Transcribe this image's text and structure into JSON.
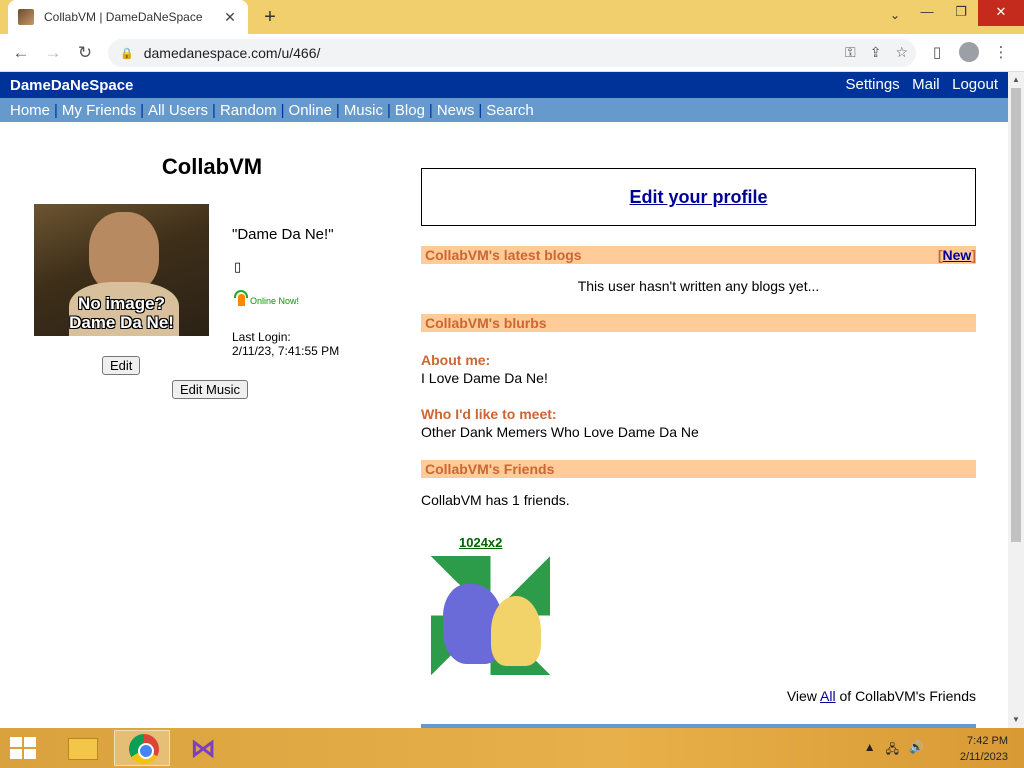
{
  "browser": {
    "tab_title": "CollabVM | DameDaNeSpace",
    "url": "damedanespace.com/u/466/"
  },
  "site": {
    "name": "DameDaNeSpace",
    "top_links": [
      "Settings",
      "Mail",
      "Logout"
    ],
    "nav": [
      "Home",
      "My Friends",
      "All Users",
      "Random",
      "Online",
      "Music",
      "Blog",
      "News",
      "Search"
    ]
  },
  "profile": {
    "name": "CollabVM",
    "image_caption_line1": "No image?",
    "image_caption_line2": "Dame Da Ne!",
    "quote": "\"Dame Da Ne!\"",
    "placeholder_glyph": "▯",
    "online_status": "Online Now!",
    "last_login_label": "Last Login:",
    "last_login_value": "2/11/23, 7:41:55 PM",
    "edit_button": "Edit",
    "edit_music_button": "Edit Music"
  },
  "right": {
    "edit_profile": "Edit your profile",
    "blogs_header": "CollabVM's latest blogs",
    "new_bracket_open": "[",
    "new_link": "New",
    "new_bracket_close": "]",
    "blogs_empty": "This user hasn't written any blogs yet...",
    "blurbs_header": "CollabVM's blurbs",
    "about_label": "About me:",
    "about_value": "I Love Dame Da Ne!",
    "meet_label": "Who I'd like to meet:",
    "meet_value": "Other Dank Memers Who Love Dame Da Ne",
    "friends_header": "CollabVM's Friends",
    "friends_count_text": "CollabVM has 1 friends.",
    "friend_name": "1024x2",
    "view_all_prefix": "View ",
    "view_all_link": "All",
    "view_all_suffix": " of CollabVM's Friends"
  },
  "taskbar": {
    "time": "7:42 PM",
    "date": "2/11/2023"
  }
}
